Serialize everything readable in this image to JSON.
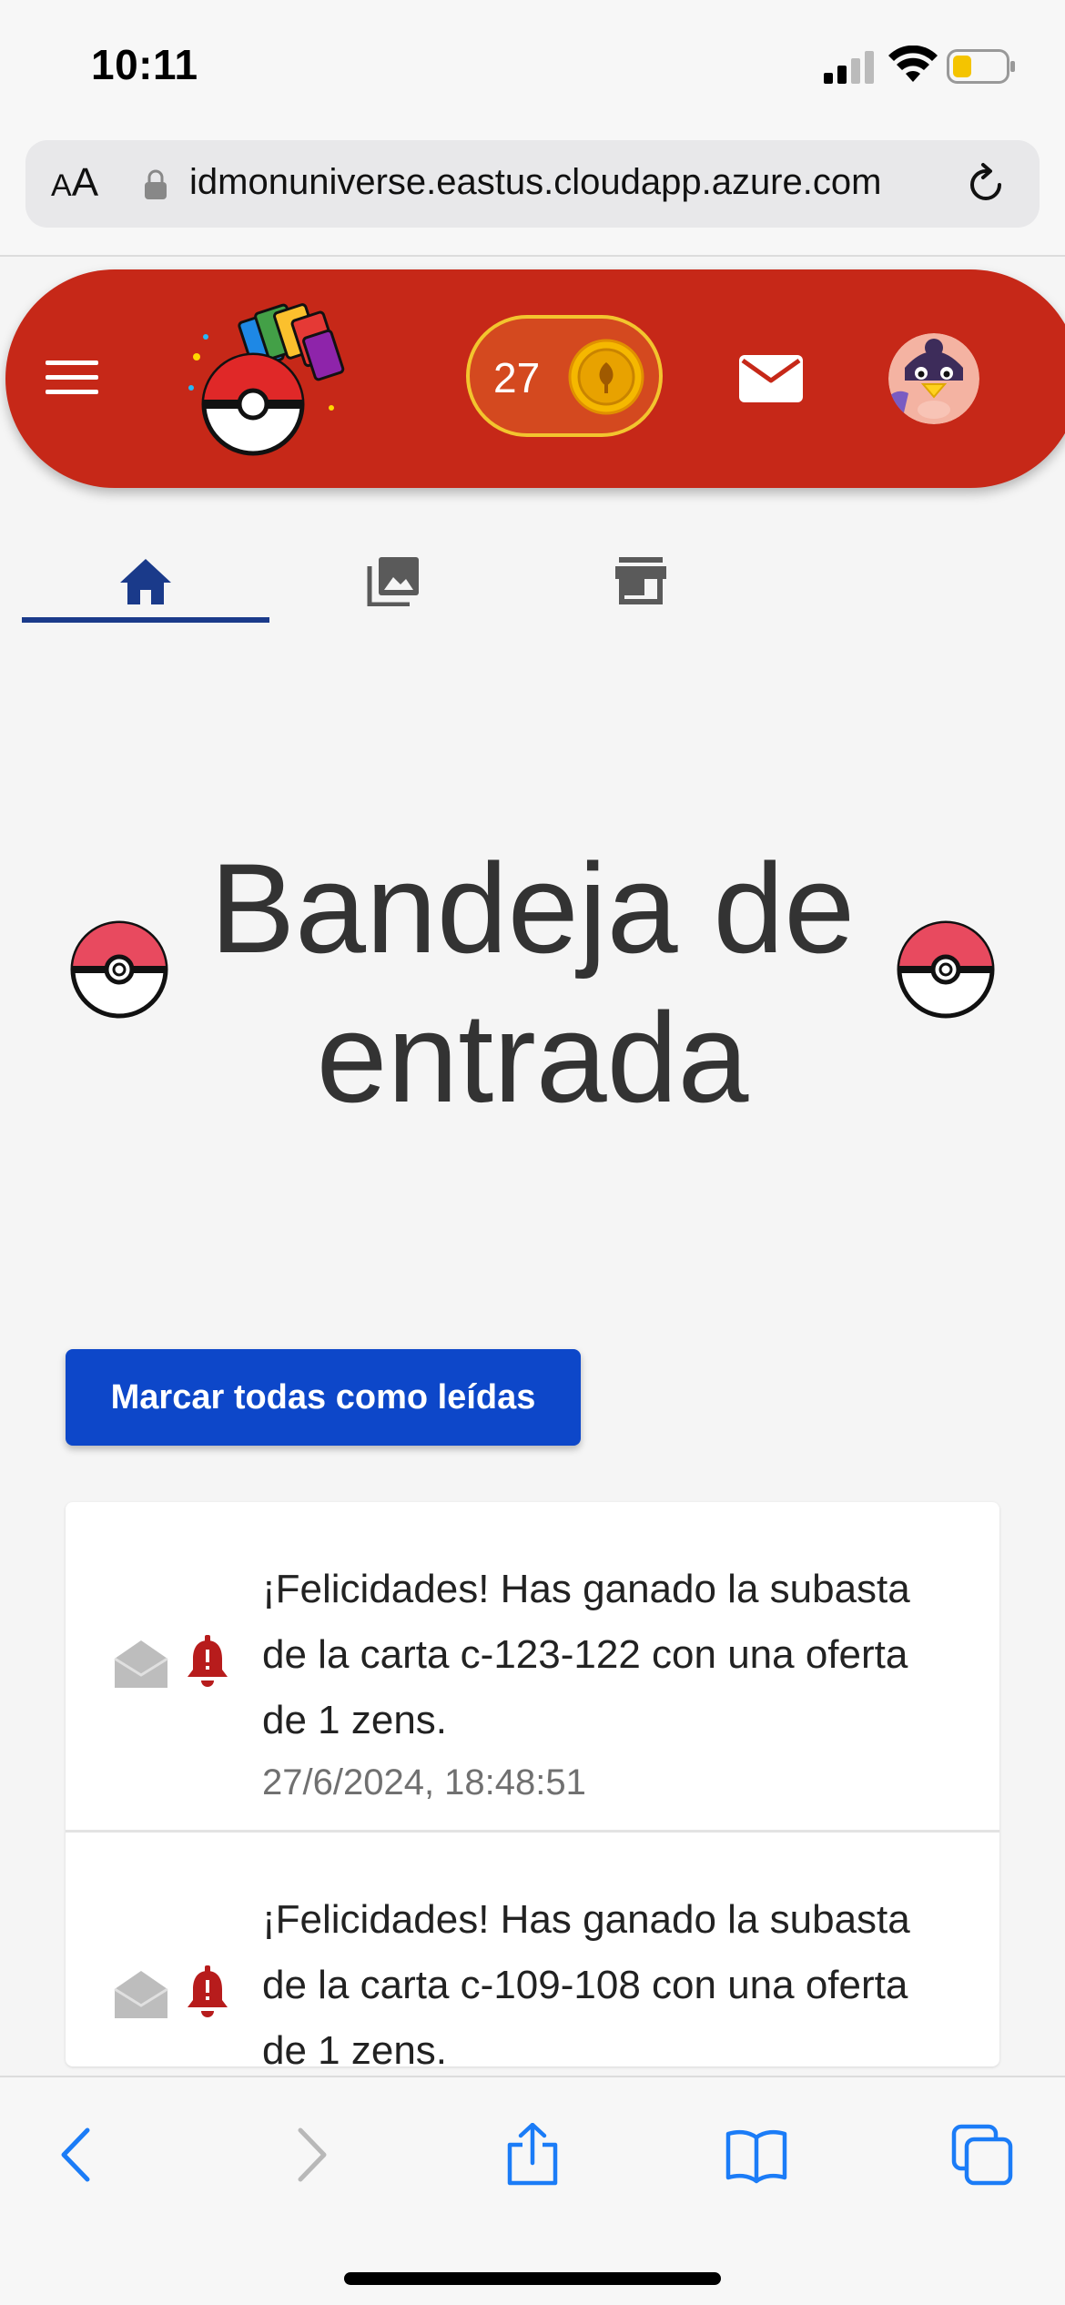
{
  "status": {
    "time": "10:11"
  },
  "browser": {
    "aa_label_small": "A",
    "aa_label_large": "A",
    "url": "idmonuniverse.eastus.cloudapp.azure.com"
  },
  "header": {
    "coins": "27"
  },
  "tabs": [
    {
      "name": "home",
      "icon": "home-icon",
      "active": true
    },
    {
      "name": "gallery",
      "icon": "gallery-icon",
      "active": false
    },
    {
      "name": "store",
      "icon": "store-icon",
      "active": false
    }
  ],
  "page": {
    "title": "Bandeja de entrada"
  },
  "actions": {
    "mark_all_read": "Marcar todas como leídas"
  },
  "notifications": [
    {
      "message": "¡Felicidades! Has ganado la subasta de la carta c-123-122 con una oferta de 1 zens.",
      "date": "27/6/2024, 18:48:51"
    },
    {
      "message": "¡Felicidades! Has ganado la subasta de la carta c-109-108 con una oferta de 1 zens.",
      "date": ""
    }
  ],
  "colors": {
    "header_red": "#c62818",
    "primary_blue": "#0d47c9",
    "tab_indicator": "#1a3a8a",
    "bell_red": "#b71c1c",
    "coin_gold": "#f3c52e"
  }
}
